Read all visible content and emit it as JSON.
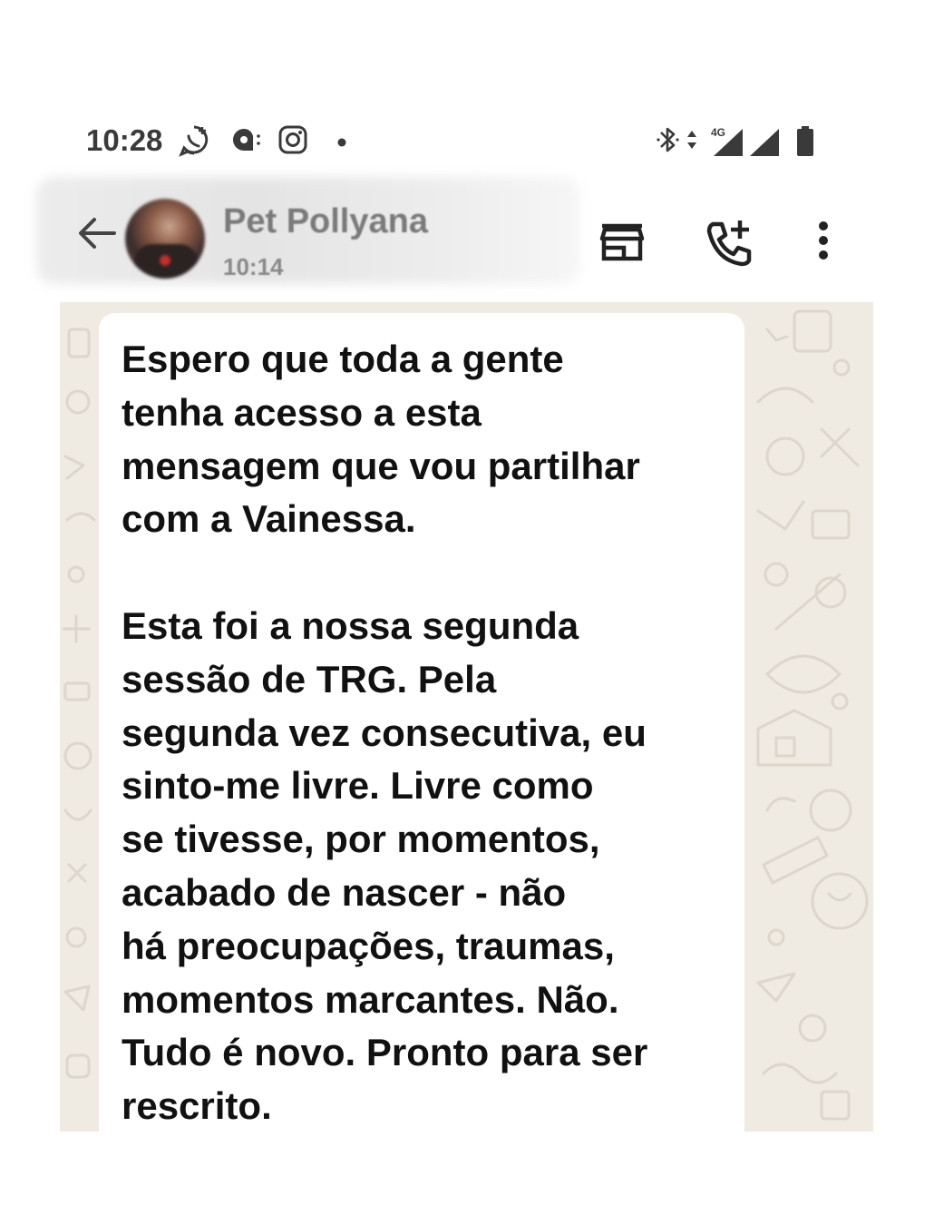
{
  "status_bar": {
    "time": "10:28",
    "left_icons": [
      "whatsapp-business-icon",
      "messenger-icon",
      "instagram-icon",
      "dot-icon"
    ],
    "right_icons": [
      "bluetooth-icon",
      "data-arrows-icon",
      "signal-4g-icon",
      "signal-icon",
      "battery-icon"
    ],
    "network_label": "4G"
  },
  "header": {
    "contact_name": "Pet Pollyana",
    "contact_status": "10:14",
    "actions": [
      "store-icon",
      "add-call-icon",
      "more-vert-icon"
    ]
  },
  "chat": {
    "message": "Espero que toda a gente\ntenha acesso a esta\nmensagem que vou partilhar\ncom a Vainessa.\n\nEsta foi a nossa segunda\nsessão de TRG. Pela\nsegunda vez consecutiva, eu\nsinto-me livre. Livre como\nse tivesse, por momentos,\nacabado de nascer - não\nhá preocupações, traumas,\nmomentos marcantes. Não.\nTudo é novo. Pronto para ser\nrescrito."
  },
  "colors": {
    "chat_background": "#efeae2",
    "bubble": "#ffffff",
    "text": "#111111",
    "icon": "#222222"
  }
}
